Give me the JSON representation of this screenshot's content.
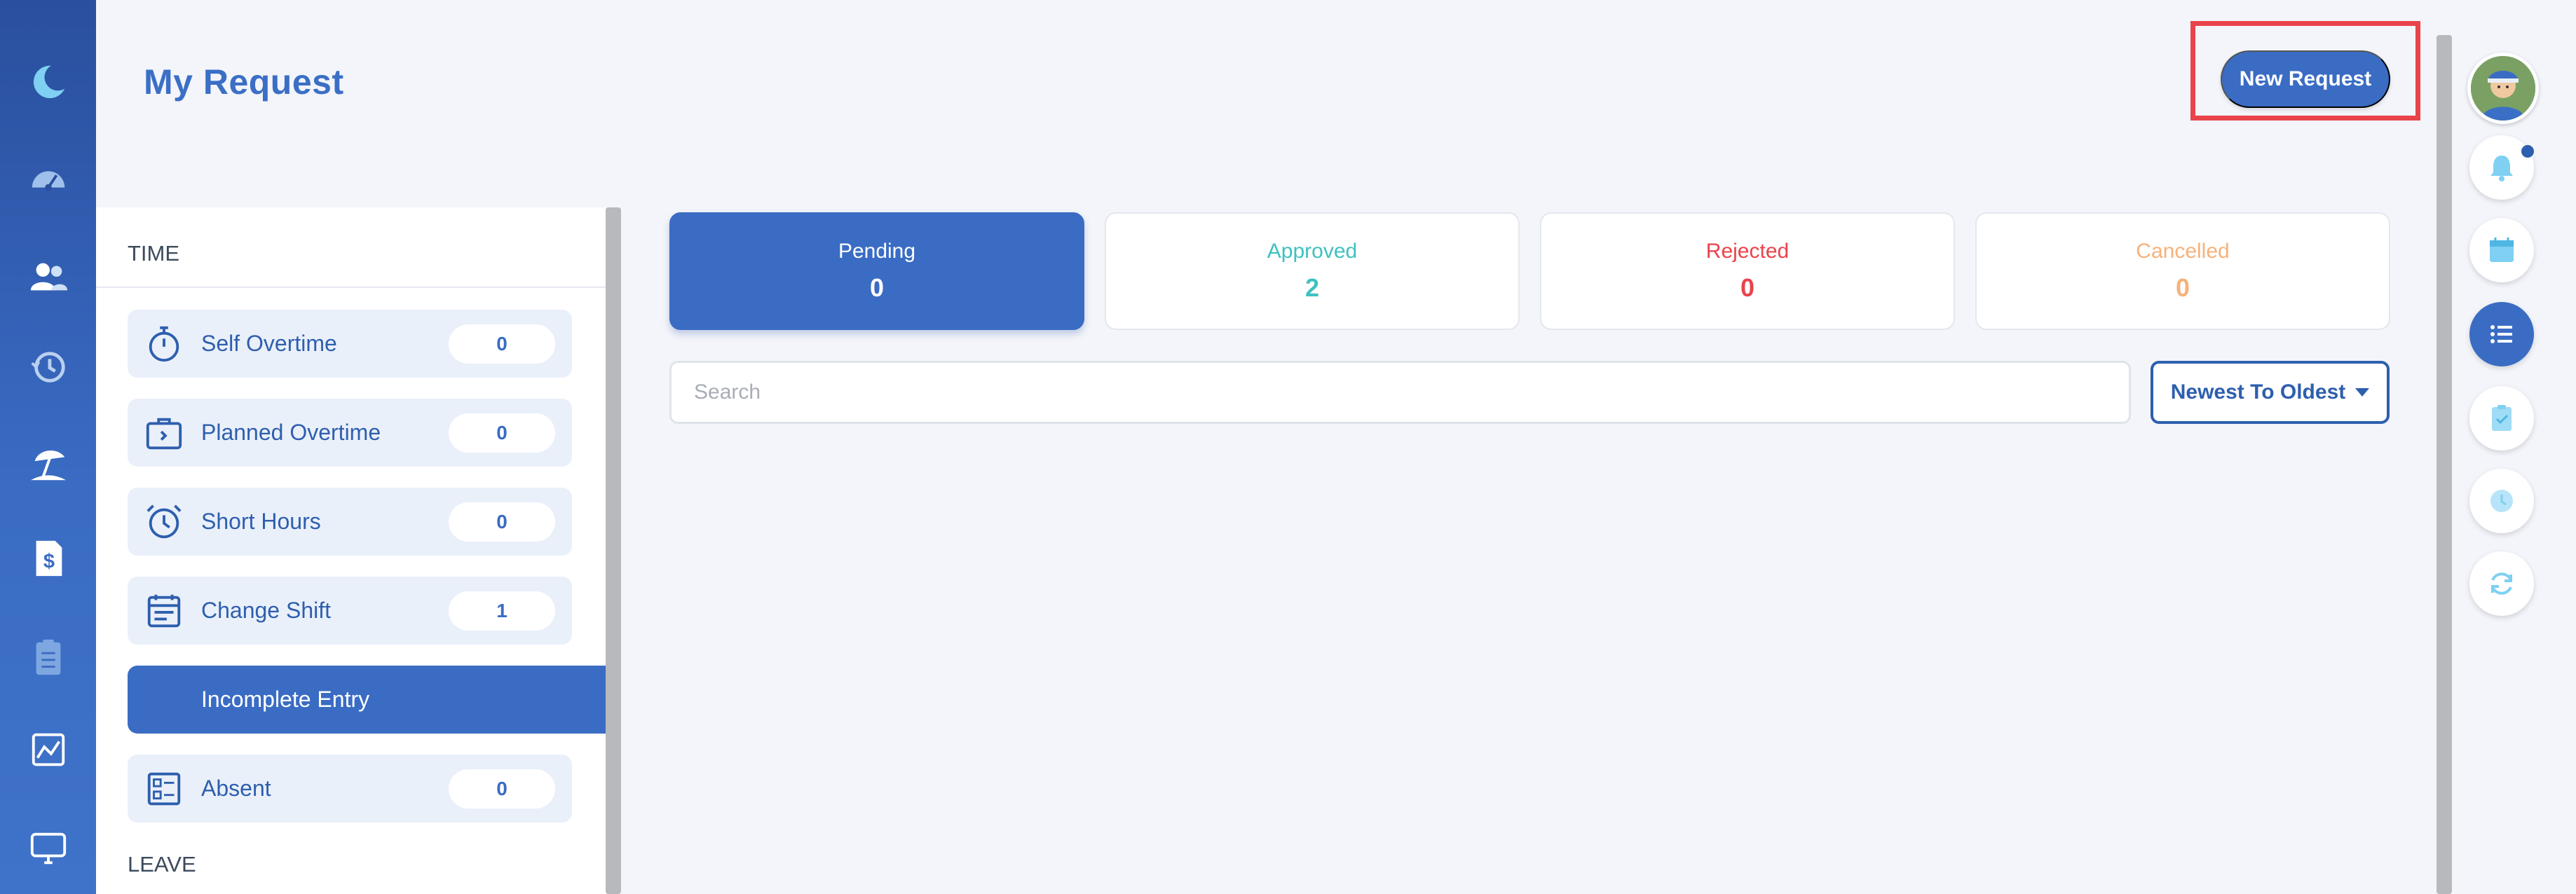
{
  "page": {
    "title": "My Request",
    "new_request_label": "New Request"
  },
  "sidebar_nav": {
    "icons": [
      "moon-logo-icon",
      "dashboard-gauge-icon",
      "people-icon",
      "history-clock-icon",
      "beach-umbrella-icon",
      "payroll-dollar-icon",
      "clipboard-list-icon",
      "chart-icon",
      "monitor-icon"
    ]
  },
  "categories": {
    "time_header": "TIME",
    "leave_header": "LEAVE",
    "items": [
      {
        "label": "Self Overtime",
        "count": "0",
        "icon": "stopwatch-icon"
      },
      {
        "label": "Planned Overtime",
        "count": "0",
        "icon": "briefcase-icon"
      },
      {
        "label": "Short Hours",
        "count": "0",
        "icon": "alarm-clock-icon"
      },
      {
        "label": "Change Shift",
        "count": "1",
        "icon": "calendar-icon"
      },
      {
        "label": "Incomplete Entry",
        "count": "",
        "icon": ""
      },
      {
        "label": "Absent",
        "count": "0",
        "icon": "list-checkbox-icon"
      }
    ],
    "active_index": 4
  },
  "status_tabs": [
    {
      "label": "Pending",
      "count": "0",
      "color": "#ffffff",
      "active": true
    },
    {
      "label": "Approved",
      "count": "2",
      "color": "#3ec1c1",
      "active": false
    },
    {
      "label": "Rejected",
      "count": "0",
      "color": "#e9434b",
      "active": false
    },
    {
      "label": "Cancelled",
      "count": "0",
      "color": "#f6b27a",
      "active": false
    }
  ],
  "search": {
    "placeholder": "Search",
    "value": ""
  },
  "sort": {
    "label": "Newest To Oldest"
  },
  "right_rail": {
    "icons": [
      "bell-icon",
      "calendar-icon",
      "list-icon",
      "clipboard-check-icon",
      "clock-icon",
      "refresh-icon"
    ],
    "active_index": 2
  },
  "colors": {
    "primary": "#3a6cc4",
    "primary_dark": "#2e5fae",
    "highlight": "#e9434b",
    "background": "#f3f5fa"
  }
}
